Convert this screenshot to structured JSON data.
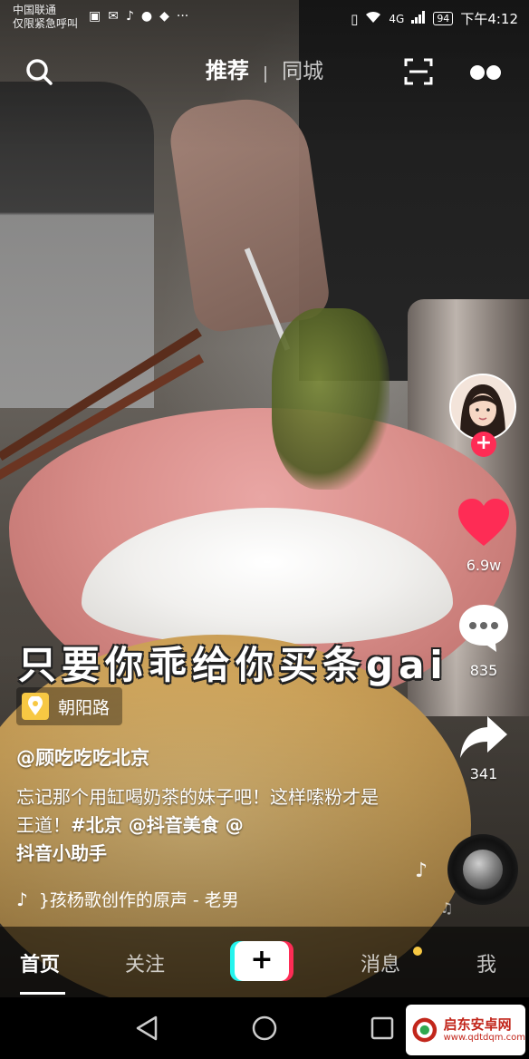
{
  "status_bar": {
    "carrier_line1": "中国联通",
    "carrier_line2": "仅限紧急呼叫",
    "network": "4G",
    "battery": "94",
    "time": "下午4:12"
  },
  "top_nav": {
    "tab_recommend": "推荐",
    "tab_local": "同城"
  },
  "subtitle": "只要你乖给你买条gai",
  "right_rail": {
    "likes": "6.9w",
    "comments": "835",
    "shares": "341"
  },
  "location": {
    "label": "朝阳路"
  },
  "author": "@顾吃吃吃北京",
  "caption": {
    "text": "忘记那个用缸喝奶茶的妹子吧！这样嗦粉才是王道！",
    "tag1": "#北京",
    "mention1": " @抖音美食 @",
    "mention2": "抖音小助手"
  },
  "music": {
    "title": "}孩杨歌创作的原声 - 老男"
  },
  "tab_bar": {
    "home": "首页",
    "follow": "关注",
    "create": "+",
    "messages": "消息",
    "me": "我"
  },
  "watermark": {
    "name": "启东安卓网",
    "url": "www.qdtdqm.com"
  },
  "colors": {
    "like": "#fe2c55",
    "follow_button": "#fe2c55",
    "cyan_accent": "#25f4ee",
    "location_pin": "#f7c843",
    "notification_dot": "#f7c843"
  }
}
